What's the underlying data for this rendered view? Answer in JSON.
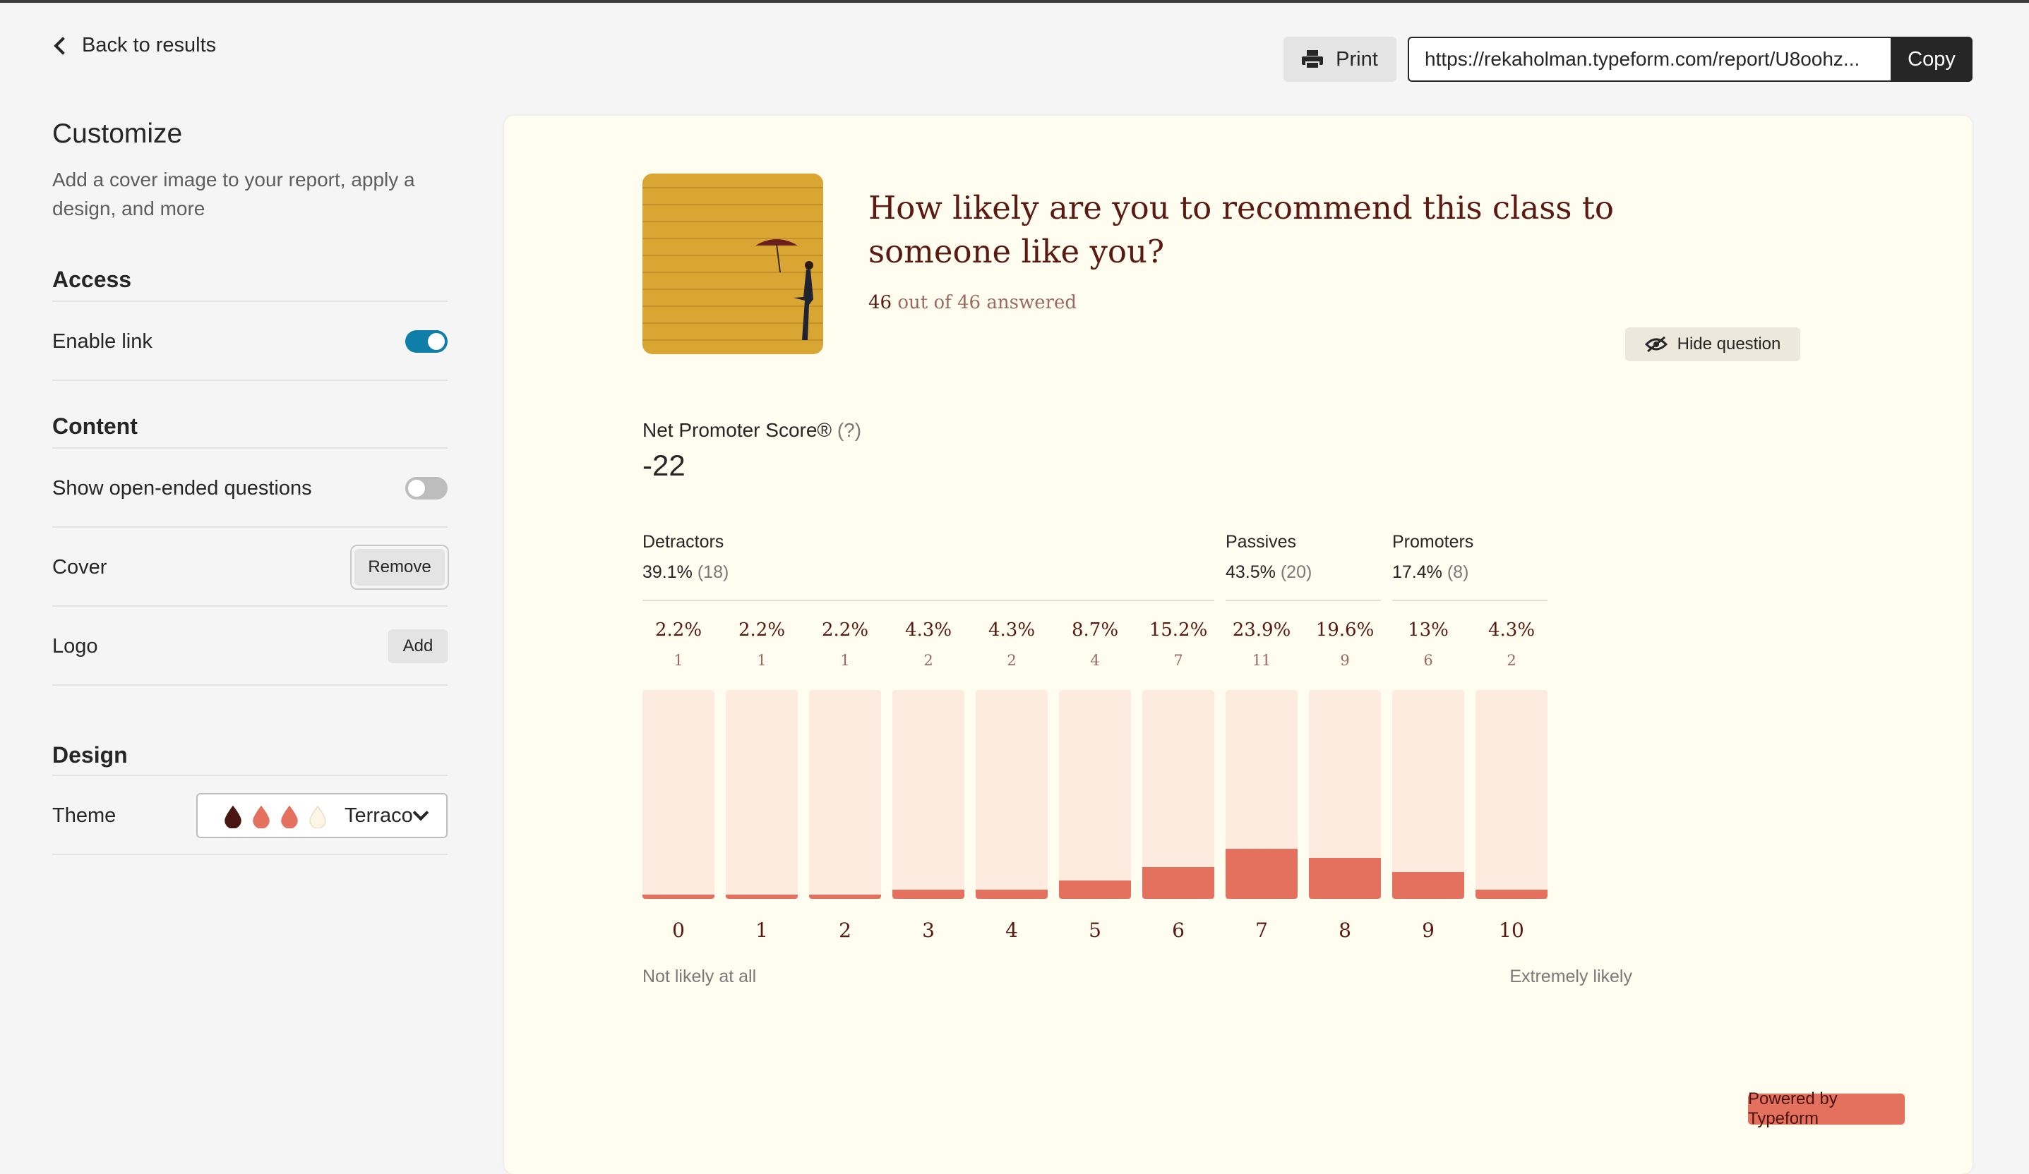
{
  "nav": {
    "back_label": "Back to results"
  },
  "sidebar": {
    "title": "Customize",
    "subtitle": "Add a cover image to your report, apply a design, and more",
    "access": {
      "heading": "Access",
      "enable_link_label": "Enable link",
      "enable_link_on": true
    },
    "content": {
      "heading": "Content",
      "open_ended_label": "Show open-ended questions",
      "open_ended_on": false,
      "cover_label": "Cover",
      "cover_button": "Remove",
      "logo_label": "Logo",
      "logo_button": "Add"
    },
    "design": {
      "heading": "Design",
      "theme_label": "Theme",
      "theme_value": "Terracotta",
      "theme_colors": [
        "#4a1510",
        "#e4705e",
        "#e4705e",
        "#fdf6e6"
      ]
    }
  },
  "toolbar": {
    "print_label": "Print",
    "url_value": "https://rekaholman.typeform.com/report/U8oohz...",
    "copy_label": "Copy"
  },
  "report": {
    "question": "How likely are you to recommend this class to someone like you?",
    "answered_count": "46",
    "answered_mid": "out of",
    "answered_total": "46",
    "answered_suffix": "answered",
    "hide_label": "Hide question",
    "nps_label": "Net Promoter Score®",
    "nps_help": "(?)",
    "nps_value": "-22",
    "scale_low": "Not likely at all",
    "scale_high": "Extremely likely",
    "powered": "Powered by Typeform"
  },
  "chart_data": {
    "type": "bar",
    "categories": [
      "0",
      "1",
      "2",
      "3",
      "4",
      "5",
      "6",
      "7",
      "8",
      "9",
      "10"
    ],
    "percent_labels": [
      "2.2%",
      "2.2%",
      "2.2%",
      "4.3%",
      "4.3%",
      "8.7%",
      "15.2%",
      "23.9%",
      "19.6%",
      "13%",
      "4.3%"
    ],
    "percent_values": [
      2.2,
      2.2,
      2.2,
      4.3,
      4.3,
      8.7,
      15.2,
      23.9,
      19.6,
      13,
      4.3
    ],
    "counts": [
      1,
      1,
      1,
      2,
      2,
      4,
      7,
      11,
      9,
      6,
      2
    ],
    "ylim": [
      0,
      100
    ],
    "groups": [
      {
        "name": "Detractors",
        "percent": "39.1%",
        "count": "(18)",
        "range": [
          0,
          6
        ]
      },
      {
        "name": "Passives",
        "percent": "43.5%",
        "count": "(20)",
        "range": [
          7,
          8
        ]
      },
      {
        "name": "Promoters",
        "percent": "17.4%",
        "count": "(8)",
        "range": [
          9,
          10
        ]
      }
    ],
    "colors": {
      "track": "#fdebdf",
      "fill": "#e4705e"
    }
  }
}
